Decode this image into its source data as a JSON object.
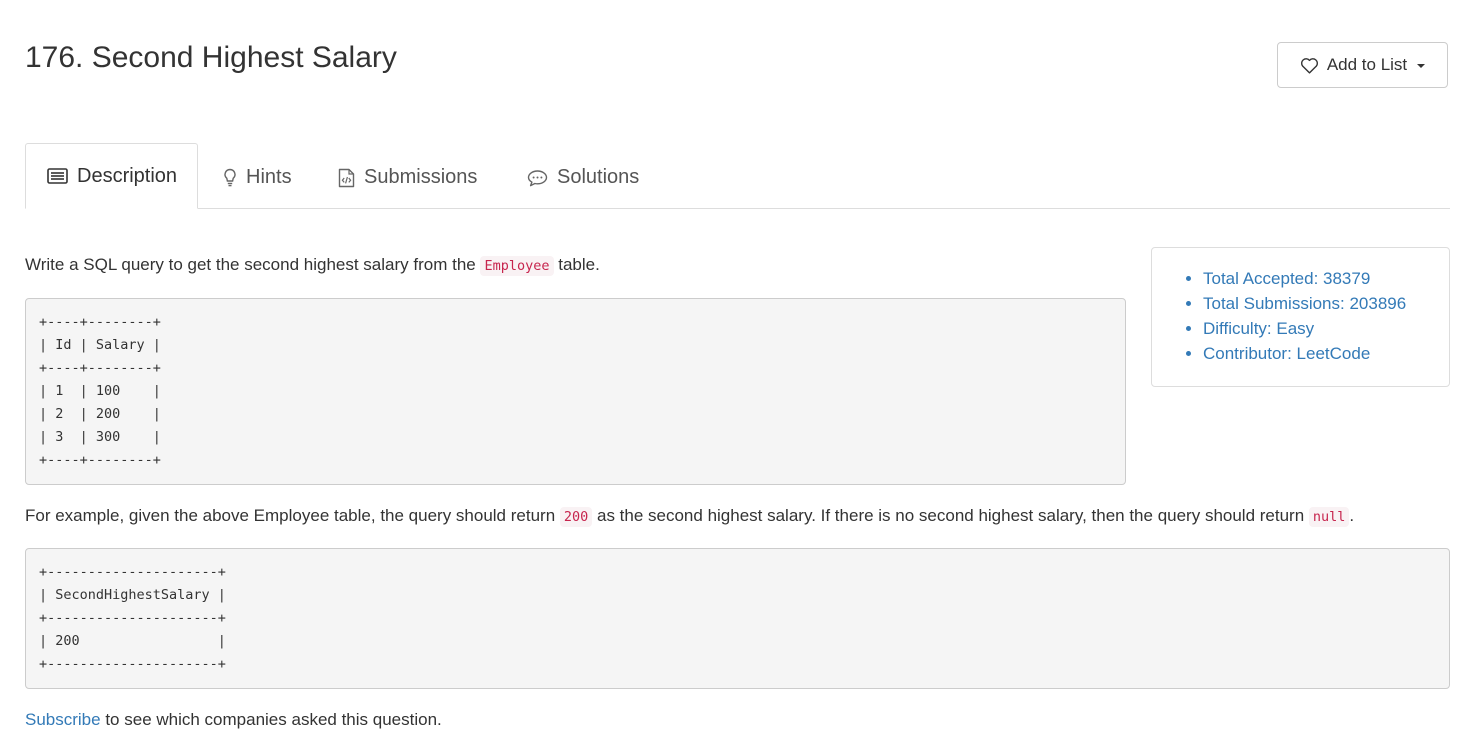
{
  "problem": {
    "title": "176. Second Highest Salary"
  },
  "actions": {
    "add_to_list_label": "Add to List"
  },
  "tabs": [
    {
      "label": "Description",
      "icon": "list-alt-icon",
      "active": true
    },
    {
      "label": "Hints",
      "icon": "lightbulb-icon",
      "active": false
    },
    {
      "label": "Submissions",
      "icon": "code-file-icon",
      "active": false
    },
    {
      "label": "Solutions",
      "icon": "comment-icon",
      "active": false
    }
  ],
  "description": {
    "intro_before": "Write a SQL query to get the second highest salary from the ",
    "intro_code": "Employee",
    "intro_after": " table.",
    "employee_table": "+----+--------+\n| Id | Salary |\n+----+--------+\n| 1  | 100    |\n| 2  | 200    |\n| 3  | 300    |\n+----+--------+",
    "example_before": "For example, given the above Employee table, the query should return ",
    "example_code_1": "200",
    "example_middle": " as the second highest salary. If there is no second highest salary, then the query should return ",
    "example_code_2": "null",
    "example_after": ".",
    "result_table": "+---------------------+\n| SecondHighestSalary |\n+---------------------+\n| 200                 |\n+---------------------+"
  },
  "stats": {
    "total_accepted": "Total Accepted: 38379",
    "total_submissions": "Total Submissions: 203896",
    "difficulty": "Difficulty: Easy",
    "contributor": "Contributor: LeetCode"
  },
  "footer": {
    "subscribe_link": "Subscribe",
    "subscribe_text": " to see which companies asked this question."
  },
  "colors": {
    "link": "#337ab7",
    "inline_code": "#c7254e",
    "inline_code_bg": "#f9f2f4",
    "code_block_bg": "#f5f5f5",
    "border": "#dddddd"
  }
}
